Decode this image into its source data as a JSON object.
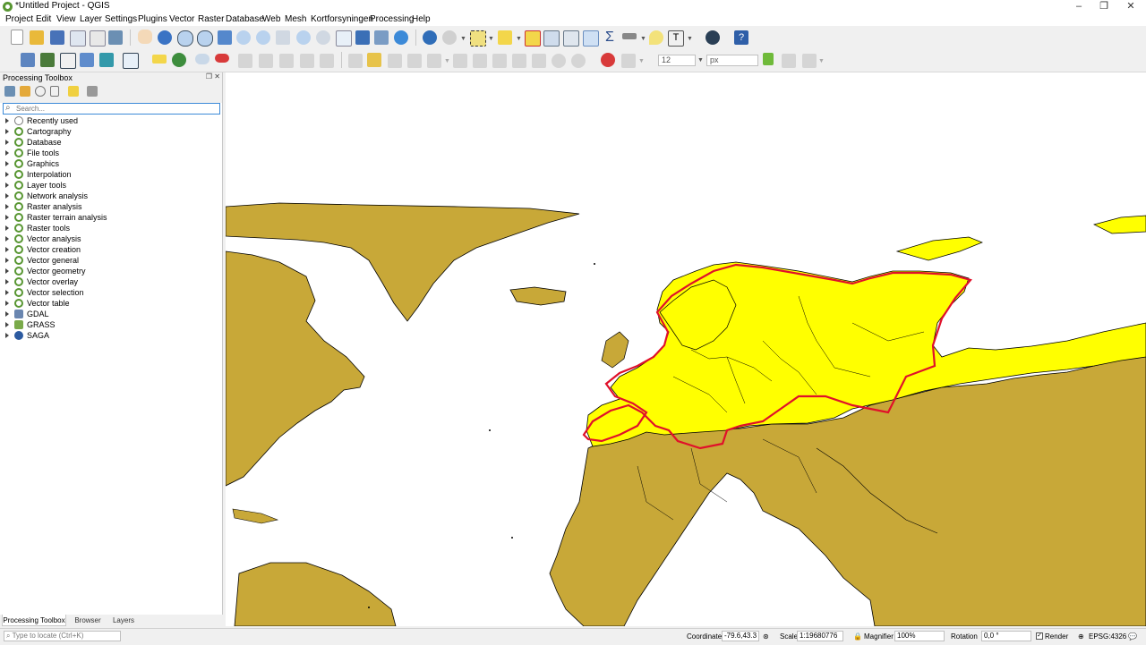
{
  "window": {
    "title": "*Untitled Project - QGIS"
  },
  "menu": [
    "Project",
    "Edit",
    "View",
    "Layer",
    "Settings",
    "Plugins",
    "Vector",
    "Raster",
    "Database",
    "Web",
    "Mesh",
    "Kortforsyningen",
    "Processing",
    "Help"
  ],
  "toolbar": {
    "font_size_value": "12",
    "unit_value": "px"
  },
  "processing_toolbox": {
    "title": "Processing Toolbox",
    "search_placeholder": "Search...",
    "items": [
      {
        "label": "Recently used",
        "icon": "clock-icon"
      },
      {
        "label": "Cartography",
        "icon": "qgis-icon"
      },
      {
        "label": "Database",
        "icon": "qgis-icon"
      },
      {
        "label": "File tools",
        "icon": "qgis-icon"
      },
      {
        "label": "Graphics",
        "icon": "qgis-icon"
      },
      {
        "label": "Interpolation",
        "icon": "qgis-icon"
      },
      {
        "label": "Layer tools",
        "icon": "qgis-icon"
      },
      {
        "label": "Network analysis",
        "icon": "qgis-icon"
      },
      {
        "label": "Raster analysis",
        "icon": "qgis-icon"
      },
      {
        "label": "Raster terrain analysis",
        "icon": "qgis-icon"
      },
      {
        "label": "Raster tools",
        "icon": "qgis-icon"
      },
      {
        "label": "Vector analysis",
        "icon": "qgis-icon"
      },
      {
        "label": "Vector creation",
        "icon": "qgis-icon"
      },
      {
        "label": "Vector general",
        "icon": "qgis-icon"
      },
      {
        "label": "Vector geometry",
        "icon": "qgis-icon"
      },
      {
        "label": "Vector overlay",
        "icon": "qgis-icon"
      },
      {
        "label": "Vector selection",
        "icon": "qgis-icon"
      },
      {
        "label": "Vector table",
        "icon": "qgis-icon"
      },
      {
        "label": "GDAL",
        "icon": "gdal-icon"
      },
      {
        "label": "GRASS",
        "icon": "grass-icon"
      },
      {
        "label": "SAGA",
        "icon": "saga-icon"
      }
    ]
  },
  "dock_tabs": [
    "Processing Toolbox",
    "Browser",
    "Layers"
  ],
  "status": {
    "locate_placeholder": "Type to locate (Ctrl+K)",
    "coordinate_label": "Coordinate",
    "coordinate_value": "-79.6,43.3",
    "scale_label": "Scale",
    "scale_value": "1:19680776",
    "magnifier_label": "Magnifier",
    "magnifier_value": "100%",
    "rotation_label": "Rotation",
    "rotation_value": "0,0 °",
    "render_label": "Render",
    "crs_label": "EPSG:4326"
  },
  "colors": {
    "land": "#c8a838",
    "selected": "#ffff00",
    "highlight_outline": "#e0102a",
    "border": "#000000"
  }
}
